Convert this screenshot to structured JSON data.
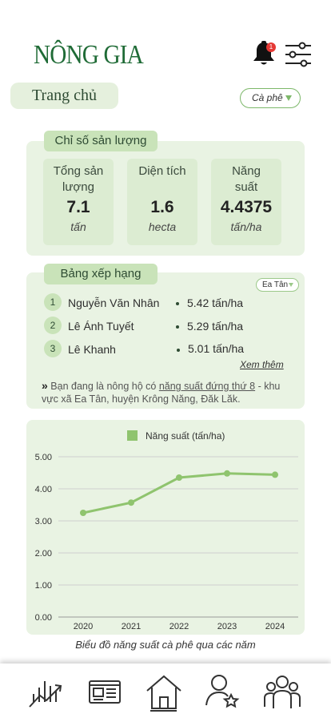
{
  "header": {
    "logo": "NÔNG GIA",
    "notification_count": "1"
  },
  "page": {
    "title": "Trang chủ",
    "crop_select": "Cà phê"
  },
  "production": {
    "title": "Chỉ số sản lượng",
    "stats": [
      {
        "label": "Tổng sản lượng",
        "value": "7.1",
        "unit": "tấn"
      },
      {
        "label": "Diện tích",
        "value": "1.6",
        "unit": "hecta"
      },
      {
        "label": "Năng suất",
        "value": "4.4375",
        "unit": "tấn/ha"
      }
    ]
  },
  "ranking": {
    "title": "Bảng xếp hạng",
    "area_select": "Ea Tân",
    "rows": [
      {
        "rank": "1",
        "name": "Nguyễn Văn Nhân",
        "value": "5.42 tấn/ha"
      },
      {
        "rank": "2",
        "name": "Lê Ánh Tuyết",
        "value": "5.29 tấn/ha"
      },
      {
        "rank": "3",
        "name": "Lê Khanh",
        "value": "5.01 tấn/ha"
      }
    ],
    "see_more": "Xem thêm",
    "note_prefix": "Bạn đang là nông  hộ có ",
    "note_highlight": "năng suất đứng thứ 8",
    "note_suffix": " - khu vực xã Ea Tân, huyện Krông Năng, Đăk Lăk."
  },
  "chart_data": {
    "type": "line",
    "x": [
      "2020",
      "2021",
      "2022",
      "2023",
      "2024"
    ],
    "series": [
      {
        "name": "Năng suất (tấn/ha)",
        "values": [
          3.25,
          3.57,
          4.35,
          4.48,
          4.44
        ]
      }
    ],
    "yticks": [
      "0.00",
      "1.00",
      "2.00",
      "3.00",
      "4.00",
      "5.00"
    ],
    "ylim": [
      0,
      5
    ],
    "grid": true,
    "legend": "top",
    "color": "#8fc46e"
  },
  "chart_caption": "Biểu đồ năng suất cà phê qua các năm",
  "nav": {
    "items": [
      "stats-icon",
      "news-icon",
      "home-icon",
      "user-star-icon",
      "community-icon"
    ],
    "active": "home-icon"
  }
}
